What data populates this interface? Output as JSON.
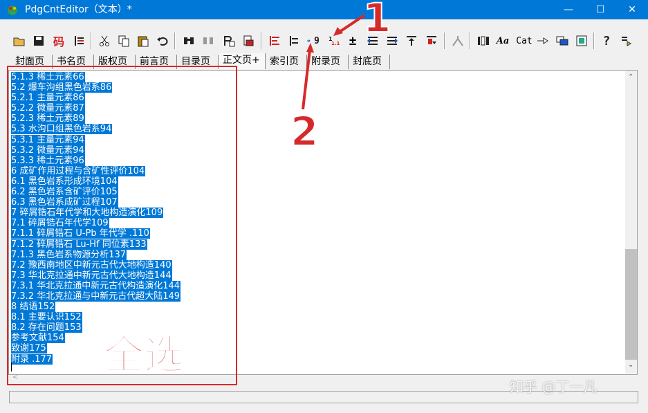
{
  "window": {
    "title": "PdgCntEditor（文本）*",
    "minimize": "—",
    "maximize": "☐",
    "close": "✕"
  },
  "toolbar": {
    "code_button": "码",
    "nine_button": "9",
    "plus_minus_button": "±",
    "font_button": "Aa",
    "cat_button": "Cat",
    "help_button": "?"
  },
  "tabs": [
    "封面页",
    "书名页",
    "版权页",
    "前言页",
    "目录页",
    "正文页+",
    "索引页",
    "附录页",
    "封底页"
  ],
  "active_tab": "正文页+",
  "editor": {
    "lines": [
      "5.1.3 稀土元素66",
      "5.2 爆车沟组黑色岩系86",
      "5.2.1 主量元素86",
      "5.2.2 微量元素87",
      "5.2.3 稀土元素89",
      "5.3 水沟口组黑色岩系94",
      "5.3.1 主量元素94",
      "5.3.2 微量元素94",
      "5.3.3 稀土元素96",
      "6 成矿作用过程与含矿性评价104",
      "6.1 黑色岩系形成环境104",
      "6.2 黑色岩系含矿评价105",
      "6.3 黑色岩系成矿过程107",
      "7 碎屑锆石年代学和大地构造演化109",
      "7.1 碎屑锆石年代学109",
      "7.1.1 碎屑锆石 U-Pb 年代学 .110",
      "7.1.2 碎屑锆石 Lu-Hf 同位素133",
      "7.1.3 黑色岩系物源分析137",
      "7.2 豫西南地区中新元古代大地构造140",
      "7.3 华北克拉通中新元古代大地构造144",
      "7.3.1 华北克拉通中新元古代构造演化144",
      "7.3.2 华北克拉通与中新元古代超大陆149",
      "8 结语152",
      "8.1 主要认识152",
      "8.2 存在问题153",
      "参考文献154",
      "致谢175",
      "附录 .177"
    ]
  },
  "annotations": {
    "select_all": "全选",
    "step1": "1",
    "step2": "2",
    "color": "#d62a2a"
  },
  "watermark": "知乎 @丁一凡",
  "colors": {
    "titlebar": "#0078d7",
    "selection": "#0078d7"
  }
}
